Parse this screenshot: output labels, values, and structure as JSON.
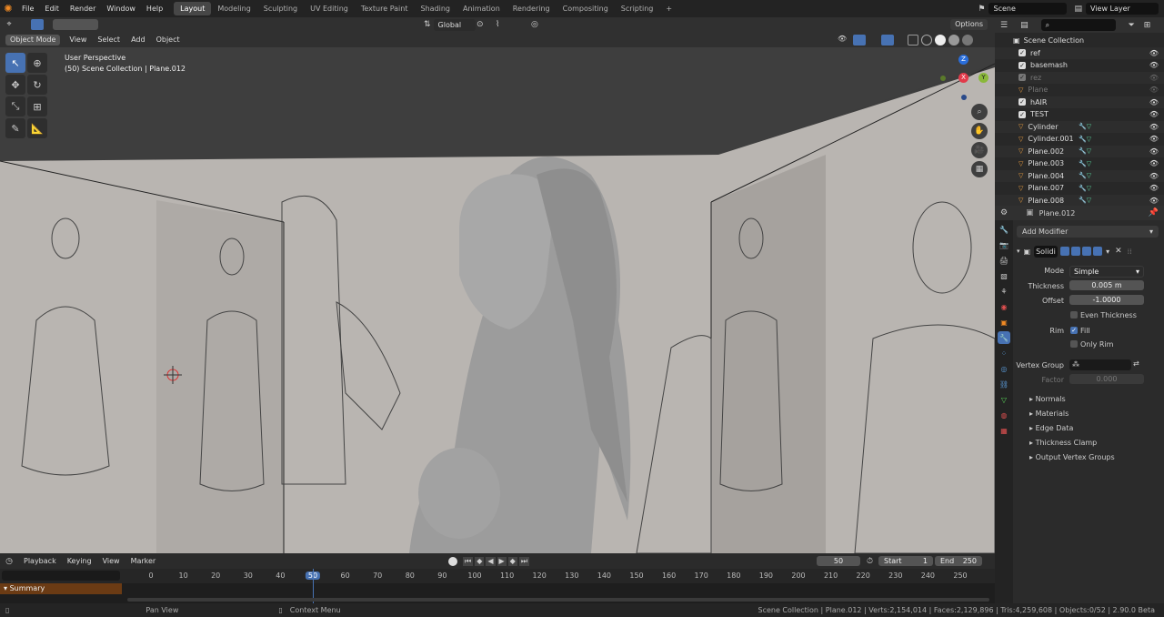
{
  "topbar": {
    "menus": [
      "File",
      "Edit",
      "Render",
      "Window",
      "Help"
    ],
    "workspaces": [
      "Layout",
      "Modeling",
      "Sculpting",
      "UV Editing",
      "Texture Paint",
      "Shading",
      "Animation",
      "Rendering",
      "Compositing",
      "Scripting"
    ],
    "active_workspace": "Layout",
    "scene": "Scene",
    "view_layer": "View Layer",
    "add_tab": "+"
  },
  "viewport_header": {
    "transform_orientation": "Global",
    "options": "Options",
    "mode": "Object Mode",
    "menus": [
      "View",
      "Select",
      "Add",
      "Object"
    ]
  },
  "viewport": {
    "perspective": "User Perspective",
    "collection_info": "(50) Scene Collection | Plane.012",
    "gizmo": {
      "x": "X",
      "y": "Y",
      "z": "Z"
    }
  },
  "timeline": {
    "menus": [
      "Playback",
      "Keying",
      "View",
      "Marker"
    ],
    "current_frame": "50",
    "start_label": "Start",
    "start": "1",
    "end_label": "End",
    "end": "250",
    "ticks": [
      "0",
      "10",
      "20",
      "30",
      "40",
      "50",
      "60",
      "70",
      "80",
      "90",
      "100",
      "110",
      "120",
      "130",
      "140",
      "150",
      "160",
      "170",
      "180",
      "190",
      "200",
      "210",
      "220",
      "230",
      "240",
      "250"
    ],
    "summary": "Summary"
  },
  "statusbar": {
    "pan": "Pan View",
    "context": "Context Menu",
    "stats": "Scene Collection | Plane.012 | Verts:2,154,014 | Faces:2,129,896 | Tris:4,259,608 | Objects:0/52 | 2.90.0 Beta"
  },
  "outliner": {
    "root": "Scene Collection",
    "rows": [
      {
        "name": "ref",
        "type": "collection"
      },
      {
        "name": "basemash",
        "type": "collection"
      },
      {
        "name": "rez",
        "type": "collection",
        "disabled": true
      },
      {
        "name": "Plane",
        "type": "object",
        "disabled": true
      },
      {
        "name": "hAIR",
        "type": "collection"
      },
      {
        "name": "TEST",
        "type": "collection"
      },
      {
        "name": "Cylinder",
        "type": "object"
      },
      {
        "name": "Cylinder.001",
        "type": "object"
      },
      {
        "name": "Plane.002",
        "type": "object"
      },
      {
        "name": "Plane.003",
        "type": "object"
      },
      {
        "name": "Plane.004",
        "type": "object"
      },
      {
        "name": "Plane.007",
        "type": "object"
      },
      {
        "name": "Plane.008",
        "type": "object"
      }
    ]
  },
  "properties": {
    "object_name": "Plane.012",
    "add_modifier": "Add Modifier",
    "modifier_name": "Solidi",
    "mode_label": "Mode",
    "mode_value": "Simple",
    "thickness_label": "Thickness",
    "thickness_value": "0.005 m",
    "offset_label": "Offset",
    "offset_value": "-1.0000",
    "even_thickness": "Even Thickness",
    "rim_label": "Rim",
    "fill": "Fill",
    "only_rim": "Only Rim",
    "vertex_group_label": "Vertex Group",
    "factor_label": "Factor",
    "factor_value": "0.000",
    "panels": [
      "Normals",
      "Materials",
      "Edge Data",
      "Thickness Clamp",
      "Output Vertex Groups"
    ]
  }
}
